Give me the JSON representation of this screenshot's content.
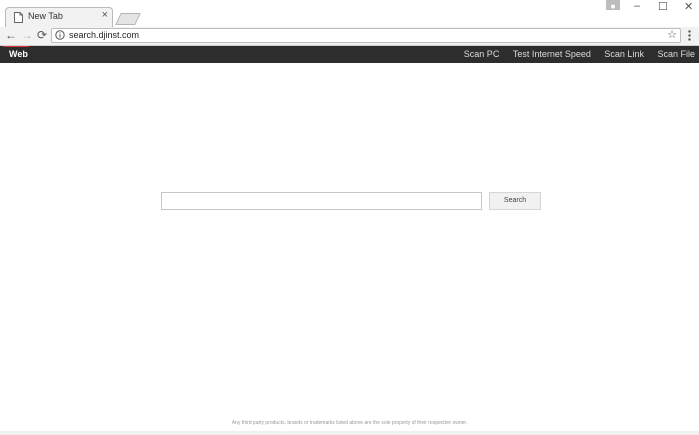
{
  "browser": {
    "tab_title": "New Tab",
    "tab_close": "×",
    "window_controls": {
      "minimize": "–",
      "maximize": "☐",
      "close": "✕"
    },
    "toolbar": {
      "back": "←",
      "forward": "→",
      "reload": "⟳",
      "star": "☆"
    },
    "url": "search.djinst.com"
  },
  "site": {
    "brand": "Web",
    "nav": [
      "Scan PC",
      "Test Internet Speed",
      "Scan Link",
      "Scan File"
    ]
  },
  "search": {
    "input_value": "",
    "button_label": "Search"
  },
  "footer_text": "Any third party products, brands or trademarks listed above are the sole property of their respective owner."
}
